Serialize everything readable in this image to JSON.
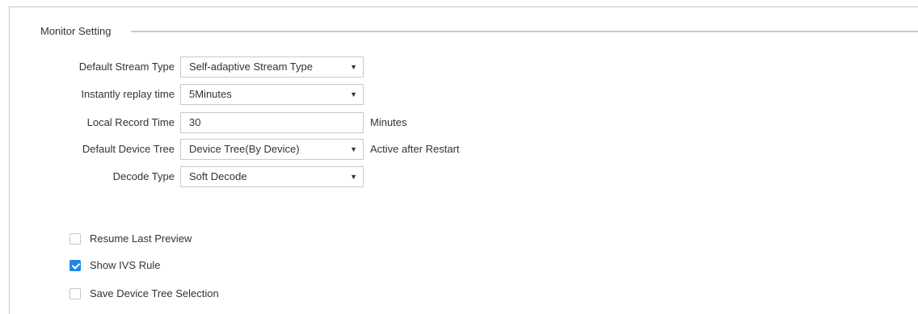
{
  "section": {
    "title": "Monitor Setting"
  },
  "fields": [
    {
      "label": "Default Stream Type",
      "value": "Self-adaptive Stream Type",
      "suffix": ""
    },
    {
      "label": "Instantly replay time",
      "value": "5Minutes",
      "suffix": ""
    },
    {
      "label": "Local Record Time",
      "value": "30",
      "suffix": "Minutes"
    },
    {
      "label": "Default Device Tree",
      "value": "Device Tree(By Device)",
      "suffix": "Active after Restart"
    },
    {
      "label": "Decode Type",
      "value": "Soft Decode",
      "suffix": ""
    }
  ],
  "dropdown_arrow": "▼",
  "checkboxes": [
    {
      "label": "Resume Last Preview",
      "checked": false
    },
    {
      "label": "Show IVS Rule",
      "checked": true
    },
    {
      "label": "Save Device Tree Selection",
      "checked": false
    }
  ],
  "colors": {
    "accent": "#1e88e5",
    "border": "#c9c9c9"
  }
}
